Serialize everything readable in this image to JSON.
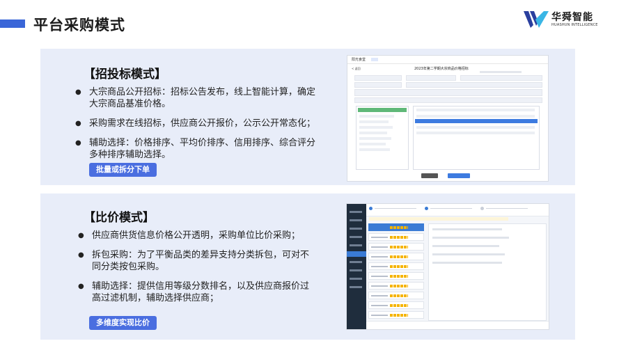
{
  "slide_title": "平台采购模式",
  "logo": {
    "name_cn": "华舜智能",
    "name_en": "HUASHUN INTELLIGENCE",
    "colors": [
      "#2a3f9e",
      "#3ab6e5"
    ]
  },
  "accent_color": "#3a66d8",
  "panel_bg": "#e8edf9",
  "sections": [
    {
      "heading": "【招投标模式】",
      "bullets": [
        "大宗商品公开招标：招标公告发布，线上智能计算，确定大宗商品基准价格。",
        "采购需求在线招标，供应商公开报价，公示公开常态化；",
        "辅助选择：价格排序、平均价排序、信用排序、综合评分多种排序辅助选择。"
      ],
      "tag": "批量或拆分下单"
    },
    {
      "heading": "【比价模式】",
      "bullets": [
        "供应商供货信息价格公开透明，采购单位比价采购；",
        "拆包采购：为了平衡品类的差异支持分类拆包，可对不同分类按包采购。",
        "辅助选择：提供信用等级分数排名，以及供应商报价过高过滤机制，辅助选择供应商；"
      ],
      "tag": "多维度实现比价"
    }
  ],
  "screenshots": [
    {
      "app_title": "阳光食堂",
      "back_label": "< 返回",
      "heading": "2023年第二学期大宗商品价格招标"
    },
    {}
  ]
}
